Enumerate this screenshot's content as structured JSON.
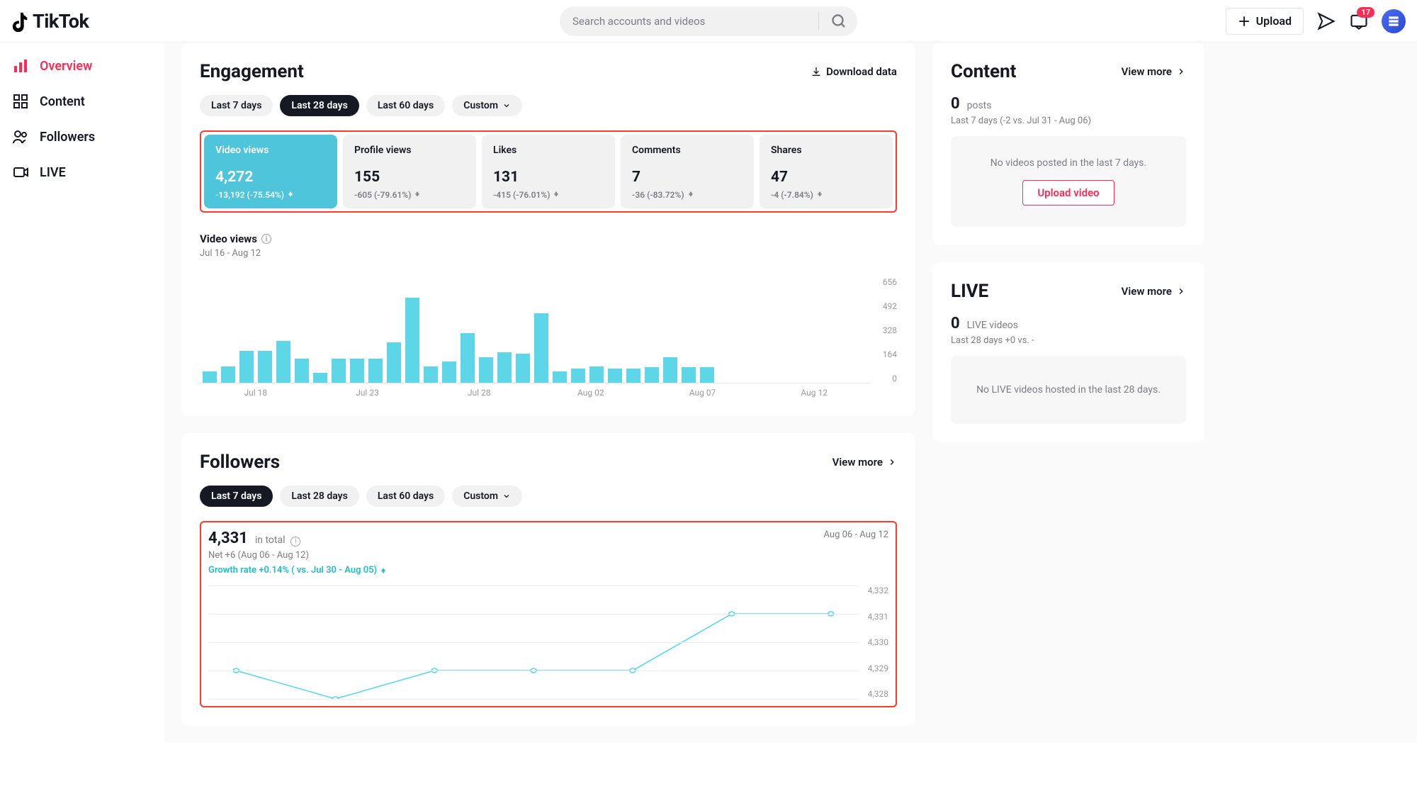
{
  "header": {
    "brand": "TikTok",
    "search_placeholder": "Search accounts and videos",
    "upload_label": "Upload",
    "inbox_count": "17"
  },
  "sidebar": {
    "items": [
      {
        "key": "overview",
        "label": "Overview",
        "active": true
      },
      {
        "key": "content",
        "label": "Content",
        "active": false
      },
      {
        "key": "followers",
        "label": "Followers",
        "active": false
      },
      {
        "key": "live",
        "label": "LIVE",
        "active": false
      }
    ]
  },
  "engagement": {
    "title": "Engagement",
    "download": "Download data",
    "range_pills": [
      {
        "label": "Last 7 days",
        "active": false
      },
      {
        "label": "Last 28 days",
        "active": true
      },
      {
        "label": "Last 60 days",
        "active": false
      },
      {
        "label": "Custom",
        "active": false,
        "dropdown": true
      }
    ],
    "metrics": [
      {
        "label": "Video views",
        "value": "4,272",
        "delta": "-13,192 (-75.54%)",
        "trend": "down",
        "active": true
      },
      {
        "label": "Profile views",
        "value": "155",
        "delta": "-605 (-79.61%)",
        "trend": "down",
        "active": false
      },
      {
        "label": "Likes",
        "value": "131",
        "delta": "-415 (-76.01%)",
        "trend": "down",
        "active": false
      },
      {
        "label": "Comments",
        "value": "7",
        "delta": "-36 (-83.72%)",
        "trend": "down",
        "active": false
      },
      {
        "label": "Shares",
        "value": "47",
        "delta": "-4 (-7.84%)",
        "trend": "down",
        "active": false
      }
    ],
    "chart_title": "Video views",
    "chart_range": "Jul 16 - Aug 12"
  },
  "chart_data": {
    "type": "bar",
    "title": "Video views",
    "xlabel": "",
    "ylabel": "",
    "ylim": [
      0,
      656
    ],
    "yticks": [
      0,
      164,
      328,
      492,
      656
    ],
    "xticks": [
      "Jul 18",
      "Jul 23",
      "Jul 28",
      "Aug 02",
      "Aug 07",
      "Aug 12"
    ],
    "categories": [
      "Jul 16",
      "Jul 17",
      "Jul 18",
      "Jul 19",
      "Jul 20",
      "Jul 21",
      "Jul 22",
      "Jul 23",
      "Jul 24",
      "Jul 25",
      "Jul 26",
      "Jul 27",
      "Jul 28",
      "Jul 29",
      "Jul 30",
      "Jul 31",
      "Aug 01",
      "Aug 02",
      "Aug 03",
      "Aug 04",
      "Aug 05",
      "Aug 06",
      "Aug 07",
      "Aug 08",
      "Aug 09",
      "Aug 10",
      "Aug 11",
      "Aug 12"
    ],
    "values": [
      70,
      100,
      200,
      200,
      260,
      150,
      60,
      150,
      150,
      150,
      250,
      530,
      100,
      130,
      310,
      160,
      190,
      180,
      430,
      70,
      90,
      100,
      90,
      90,
      95,
      160,
      95,
      95
    ]
  },
  "followers": {
    "title": "Followers",
    "view_more": "View more",
    "range_pills": [
      {
        "label": "Last 7 days",
        "active": true
      },
      {
        "label": "Last 28 days",
        "active": false
      },
      {
        "label": "Last 60 days",
        "active": false
      },
      {
        "label": "Custom",
        "active": false,
        "dropdown": true
      }
    ],
    "total": "4,331",
    "total_label": "in total",
    "net": "Net +6 (Aug 06 - Aug 12)",
    "growth": "Growth rate +0.14% ( vs. Jul 30 - Aug 05)",
    "range_text": "Aug 06 - Aug 12"
  },
  "followers_chart_data": {
    "type": "line",
    "ylim": [
      4328,
      4332
    ],
    "yticks": [
      4328,
      4329,
      4330,
      4331,
      4332
    ],
    "categories": [
      "Aug 06",
      "Aug 07",
      "Aug 08",
      "Aug 09",
      "Aug 10",
      "Aug 11",
      "Aug 12"
    ],
    "values": [
      4329,
      4328,
      4329,
      4329,
      4329,
      4331,
      4331
    ]
  },
  "content_panel": {
    "title": "Content",
    "view_more": "View more",
    "count": "0",
    "count_label": "posts",
    "subline": "Last 7 days (-2 vs. Jul 31 - Aug 06)",
    "empty_msg": "No videos posted in the last 7 days.",
    "upload_label": "Upload video"
  },
  "live_panel": {
    "title": "LIVE",
    "view_more": "View more",
    "count": "0",
    "count_label": "LIVE videos",
    "subline": "Last 28 days +0 vs. -",
    "empty_msg": "No LIVE videos hosted in the last 28 days."
  }
}
